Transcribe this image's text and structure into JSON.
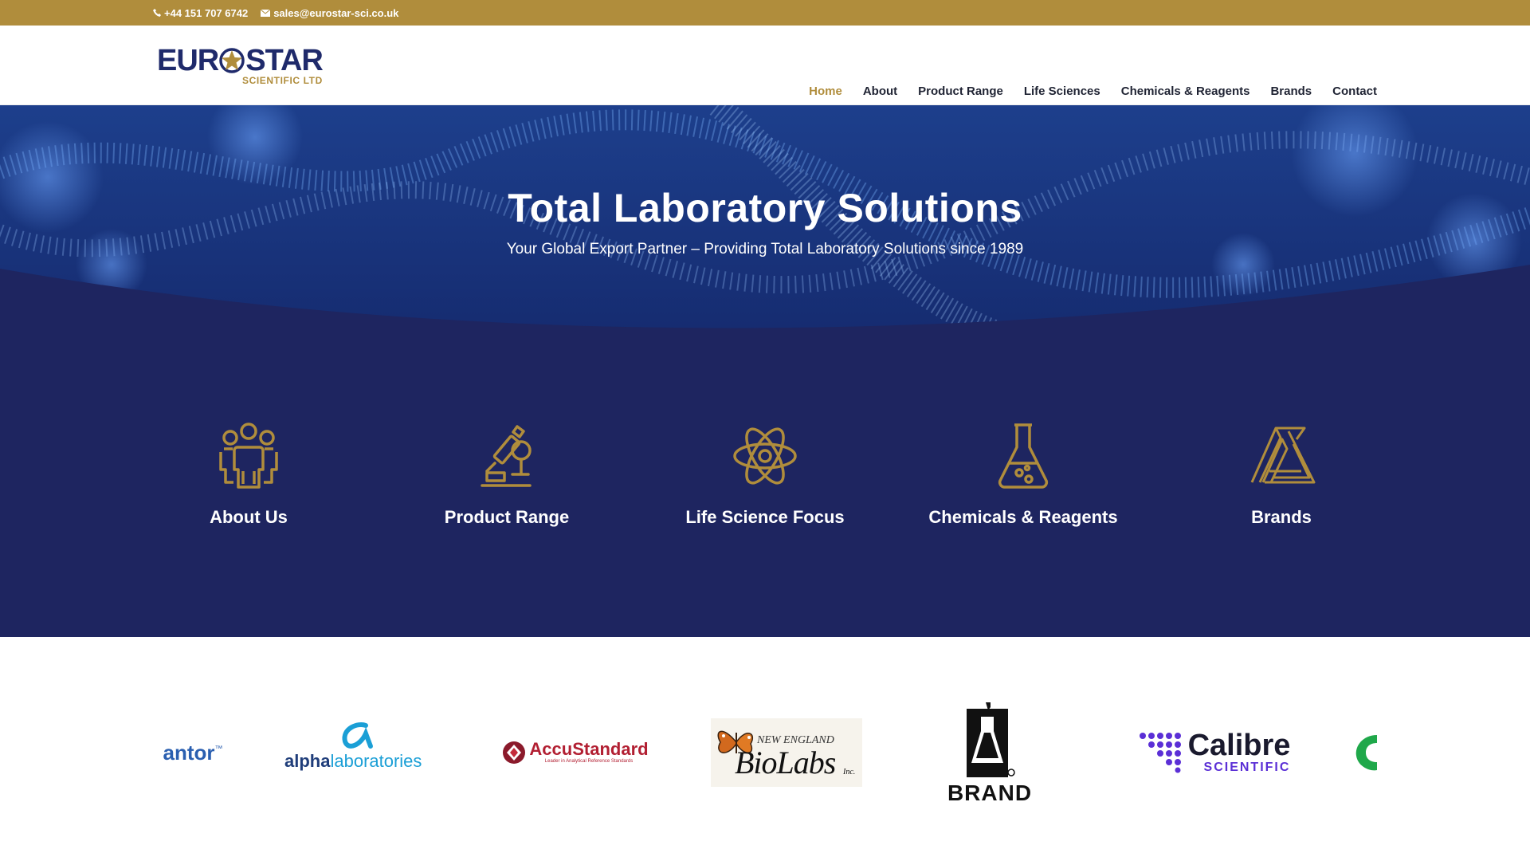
{
  "topbar": {
    "phone": "+44 151 707 6742",
    "email": "sales@eurostar-sci.co.uk"
  },
  "logo": {
    "main_left": "EUR",
    "main_right": "STAR",
    "sub": "SCIENTIFIC LTD"
  },
  "nav": {
    "items": [
      {
        "label": "Home",
        "active": true
      },
      {
        "label": "About",
        "active": false
      },
      {
        "label": "Product Range",
        "active": false
      },
      {
        "label": "Life Sciences",
        "active": false
      },
      {
        "label": "Chemicals & Reagents",
        "active": false
      },
      {
        "label": "Brands",
        "active": false
      },
      {
        "label": "Contact",
        "active": false
      }
    ]
  },
  "hero": {
    "title": "Total Laboratory Solutions",
    "subtitle": "Your Global Export Partner – Providing Total Laboratory Solutions since 1989"
  },
  "features": [
    {
      "label": "About Us",
      "icon": "team-icon"
    },
    {
      "label": "Product Range",
      "icon": "microscope-icon"
    },
    {
      "label": "Life Science Focus",
      "icon": "atom-icon"
    },
    {
      "label": "Chemicals & Reagents",
      "icon": "flask-icon"
    },
    {
      "label": "Brands",
      "icon": "triangles-icon"
    }
  ],
  "brands": {
    "items": [
      {
        "name": "Cantor (partial)",
        "text": "antor",
        "mark": "™"
      },
      {
        "name": "Alpha Laboratories",
        "text_a": "alpha",
        "text_b": "laboratories"
      },
      {
        "name": "AccuStandard",
        "text": "AccuStandard",
        "tagline": "Leader in Analytical Reference Standards"
      },
      {
        "name": "New England BioLabs",
        "text_top": "NEW ENGLAND",
        "text_main": "BioLabs",
        "suffix": "Inc."
      },
      {
        "name": "BRAND",
        "text": "BRAND"
      },
      {
        "name": "Calibre Scientific",
        "text_main": "Calibre",
        "text_sub": "SCIENTIFIC"
      },
      {
        "name": "green logo (partial)"
      }
    ]
  },
  "colors": {
    "gold": "#b08d3c",
    "navy": "#1e2560",
    "nav_text": "#1f2333"
  }
}
